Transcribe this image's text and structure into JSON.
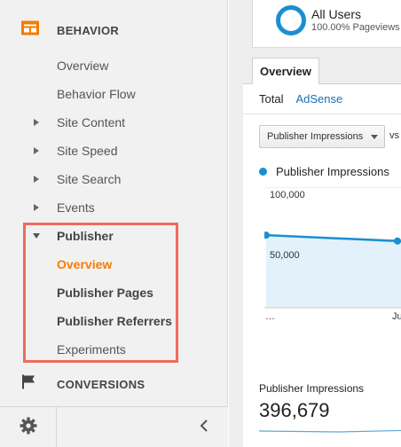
{
  "sidebar": {
    "behavior_header": {
      "label": "BEHAVIOR",
      "icon": "behavior-icon"
    },
    "items": [
      {
        "label": "Overview",
        "type": "leaf"
      },
      {
        "label": "Behavior Flow",
        "type": "leaf"
      },
      {
        "label": "Site Content",
        "type": "collapsed"
      },
      {
        "label": "Site Speed",
        "type": "collapsed"
      },
      {
        "label": "Site Search",
        "type": "collapsed"
      },
      {
        "label": "Events",
        "type": "collapsed"
      },
      {
        "label": "Publisher",
        "type": "expanded"
      },
      {
        "label": "Overview",
        "type": "sub-active"
      },
      {
        "label": "Publisher Pages",
        "type": "sub"
      },
      {
        "label": "Publisher Referrers",
        "type": "sub"
      },
      {
        "label": "Experiments",
        "type": "sub"
      }
    ],
    "conversions_header": {
      "label": "CONVERSIONS",
      "icon": "flag-icon"
    },
    "highlight_color": "#f26a5b",
    "active_color": "#f57c00"
  },
  "segment": {
    "title": "All Users",
    "subtitle": "100.00% Pageviews",
    "color": "#1a8fd1"
  },
  "tabs": {
    "overview": "Overview"
  },
  "subtabs": {
    "total": "Total",
    "adsense": "AdSense"
  },
  "metric_select": {
    "value": "Publisher Impressions",
    "vs": "vs"
  },
  "legend": {
    "label": "Publisher Impressions"
  },
  "chart_data": {
    "type": "line",
    "series": [
      {
        "name": "Publisher Impressions",
        "values": [
          62000,
          57000
        ]
      }
    ],
    "x": [
      "…",
      "Jul"
    ],
    "yticks": [
      "100,000",
      "50,000"
    ],
    "ylim": [
      0,
      100000
    ],
    "color": "#1a8fd1"
  },
  "scorecard": {
    "label": "Publisher Impressions",
    "value": "396,679"
  }
}
